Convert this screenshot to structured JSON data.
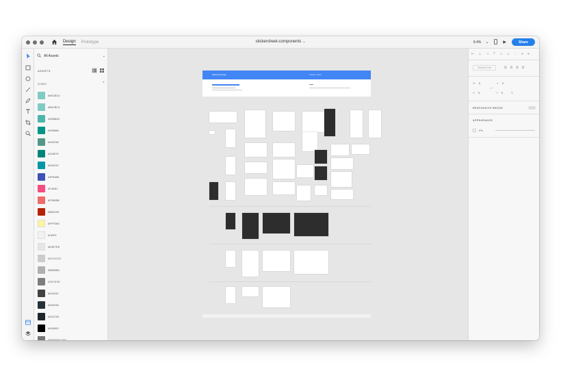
{
  "window": {
    "tabs": [
      {
        "label": "Design",
        "active": true
      },
      {
        "label": "Prototype",
        "active": false
      }
    ],
    "document_title": "stickersheet-components",
    "zoom": "8.4%",
    "share_label": "Share"
  },
  "toolbar": {
    "tools": [
      "select-tool",
      "rectangle-tool",
      "ellipse-tool",
      "line-tool",
      "pen-tool",
      "text-tool",
      "artboard-tool",
      "zoom-tool"
    ],
    "bottom": [
      "assets-panel",
      "layers-panel"
    ]
  },
  "assets": {
    "dropdown_label": "All Assets",
    "heading": "ASSETS",
    "colors_label": "Colors",
    "colors": [
      {
        "hex": "#80CBC4",
        "color": "#80cbc4"
      },
      {
        "hex": "#80CBC4",
        "color": "#80cbc4"
      },
      {
        "hex": "#4DB6AC",
        "color": "#4db6ac"
      },
      {
        "hex": "#009688",
        "color": "#009688"
      },
      {
        "hex": "#549788",
        "color": "#549788"
      },
      {
        "hex": "#018579",
        "color": "#018579"
      },
      {
        "hex": "#0097A7",
        "color": "#0097a7"
      },
      {
        "hex": "#3F51B5",
        "color": "#3f51b5"
      },
      {
        "hex": "#F4D81",
        "color": "#f44d81"
      },
      {
        "hex": "#F05B5B",
        "color": "#f06b6b"
      },
      {
        "hex": "#B62205",
        "color": "#b62205"
      },
      {
        "hex": "#FFF59D",
        "color": "#fff59d"
      },
      {
        "hex": "#CBF9",
        "color": "#f2f2f2"
      },
      {
        "hex": "#E4E7E8",
        "color": "#e4e7e8"
      },
      {
        "hex": "#CCCCCC",
        "color": "#cccccc"
      },
      {
        "hex": "#B0B0B0",
        "color": "#b0b0b0"
      },
      {
        "hex": "#7D7D7D",
        "color": "#7d7d7d"
      },
      {
        "hex": "#424242",
        "color": "#424242"
      },
      {
        "hex": "#263238",
        "color": "#263238"
      },
      {
        "hex": "#20272B",
        "color": "#20272b"
      },
      {
        "hex": "#000000",
        "color": "#000000"
      },
      {
        "hex": "#0000000 10%",
        "color": "#777777"
      }
    ]
  },
  "canvas": {
    "header_title": "Material Design",
    "header_subtitle": "Sticker Sheet",
    "accent_color": "#4285f4"
  },
  "properties": {
    "component_label": "Normal Grid",
    "w_label": "W",
    "w_value": "0",
    "h_label": "H",
    "h_value": "0",
    "x_label": "X",
    "x_value": "0",
    "y_label": "Y",
    "y_value": "0",
    "responsive_label": "RESPONSIVE RESIZE",
    "appearance_label": "APPEARANCE",
    "opacity_value": "0%"
  }
}
